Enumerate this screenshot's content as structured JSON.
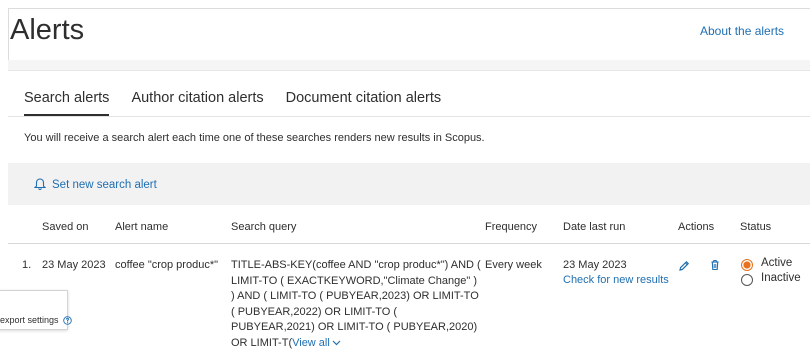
{
  "header": {
    "title": "Alerts",
    "about_link": "About the alerts"
  },
  "tabs": [
    {
      "label": "Search alerts",
      "active": true
    },
    {
      "label": "Author citation alerts",
      "active": false
    },
    {
      "label": "Document citation alerts",
      "active": false
    }
  ],
  "info_text": "You will receive a search alert each time one of these searches renders new results in Scopus.",
  "set_alert_label": "Set new search alert",
  "table": {
    "headers": {
      "saved_on": "Saved on",
      "alert_name": "Alert name",
      "search_query": "Search query",
      "frequency": "Frequency",
      "date_last_run": "Date last run",
      "actions": "Actions",
      "status": "Status"
    },
    "rows": [
      {
        "index": "1.",
        "saved_on": "23 May 2023",
        "alert_name": "coffee \"crop produc*\"",
        "search_query": "TITLE-ABS-KEY(coffee AND \"crop produc*\") AND ( LIMIT-TO ( EXACTKEYWORD,\"Climate Change\" ) ) AND ( LIMIT-TO ( PUBYEAR,2023) OR LIMIT-TO ( PUBYEAR,2022) OR LIMIT-TO ( PUBYEAR,2021) OR LIMIT-TO ( PUBYEAR,2020) OR LIMIT-T(",
        "view_all": "View all",
        "frequency": "Every week",
        "date_last_run": "23 May 2023",
        "check_results": "Check for new results",
        "status_active": "Active",
        "status_inactive": "Inactive",
        "status_selected": "Active"
      }
    ]
  },
  "export_settings": "export settings",
  "colors": {
    "link": "#1f6fb2",
    "active_radio": "#e9711c",
    "text": "#2e2e2e"
  }
}
